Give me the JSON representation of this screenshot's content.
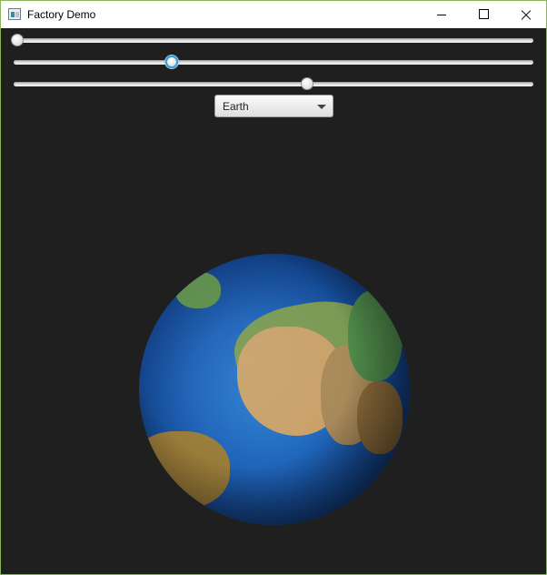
{
  "window": {
    "title": "Factory Demo"
  },
  "sliders": [
    {
      "name": "slider-1",
      "value_fraction": 0.0,
      "focused": false
    },
    {
      "name": "slider-2",
      "value_fraction": 0.302,
      "focused": true
    },
    {
      "name": "slider-3",
      "value_fraction": 0.566,
      "focused": false
    }
  ],
  "planet_select": {
    "selected": "Earth"
  },
  "colors": {
    "background": "#1f1f1f",
    "focus_ring": "#39a0dc",
    "window_border": "#8ab45a"
  },
  "icons": [
    "app-icon",
    "minimize-icon",
    "maximize-icon",
    "close-icon",
    "chevron-down-icon"
  ]
}
